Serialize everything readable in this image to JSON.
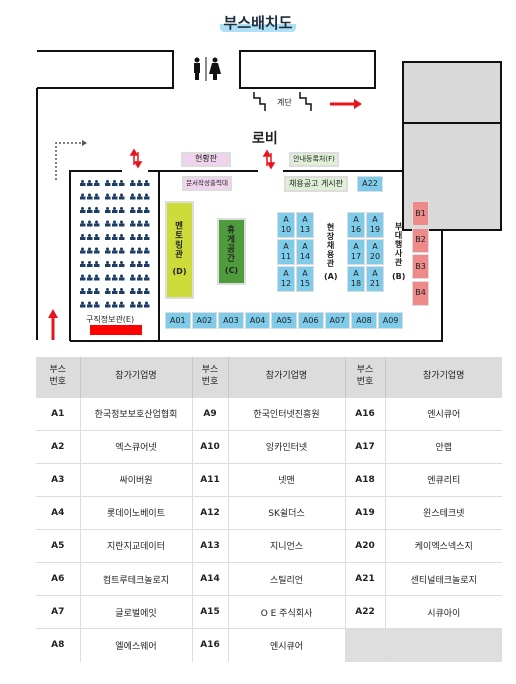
{
  "title": "부스배치도",
  "map": {
    "stairs": "계단",
    "lobby": "로비",
    "status_board": "현황판",
    "info_desk": "안내등록처(F)",
    "print_desk": "문서작성출력대",
    "job_board": "채용공고 게시판",
    "mentoring": "멘토링관",
    "mentoring_code": "(D)",
    "rest": "휴게공간",
    "rest_code": "(C)",
    "onsite": "현장채용관",
    "onsite_code": "(A)",
    "side_event": "부대행사관",
    "side_event_code": "(B)",
    "job_info": "구직정보관(E)",
    "booth_a22": "A22",
    "booths_grid": [
      "A\n10",
      "A\n13",
      "A\n11",
      "A\n14",
      "A\n12",
      "A\n15",
      "A\n16",
      "A\n19",
      "A\n17",
      "A\n20",
      "A\n18",
      "A\n21"
    ],
    "booths_b": [
      "B1",
      "B2",
      "B3",
      "B4"
    ],
    "booths_bottom": [
      "A01",
      "A02",
      "A03",
      "A04",
      "A05",
      "A06",
      "A07",
      "A08",
      "A09"
    ],
    "colors": {
      "arrow": "#e8141b",
      "booth": "#7ecbea",
      "b_booth": "#ef8a8a",
      "mentoring": "#cddc3a",
      "rest": "#4f9c3f"
    }
  },
  "table": {
    "headers": [
      "부스\n번호",
      "참가기업명",
      "부스\n번호",
      "참가기업명",
      "부스\n번호",
      "참가기업명"
    ],
    "rows": [
      [
        "A1",
        "한국정보보호산업협회",
        "A9",
        "한국인터넷진흥원",
        "A16",
        "엔시큐어"
      ],
      [
        "A2",
        "엑스큐어넷",
        "A10",
        "잉카인터넷",
        "A17",
        "안랩"
      ],
      [
        "A3",
        "싸이버원",
        "A11",
        "넷맨",
        "A18",
        "엔큐리티"
      ],
      [
        "A4",
        "롯데이노베이트",
        "A12",
        "SK쉴더스",
        "A19",
        "윈스테크넷"
      ],
      [
        "A5",
        "지란지교데이터",
        "A13",
        "지니언스",
        "A20",
        "케이엑스넥스지"
      ],
      [
        "A6",
        "컴트루테크놀로지",
        "A14",
        "스틸리언",
        "A21",
        "센티널테크놀로지"
      ],
      [
        "A7",
        "글로벌에잇",
        "A15",
        "O E 주식회사",
        "A22",
        "시큐아이"
      ],
      [
        "A8",
        "엘에스웨어",
        "A16",
        "엔시큐어",
        "",
        ""
      ]
    ]
  }
}
